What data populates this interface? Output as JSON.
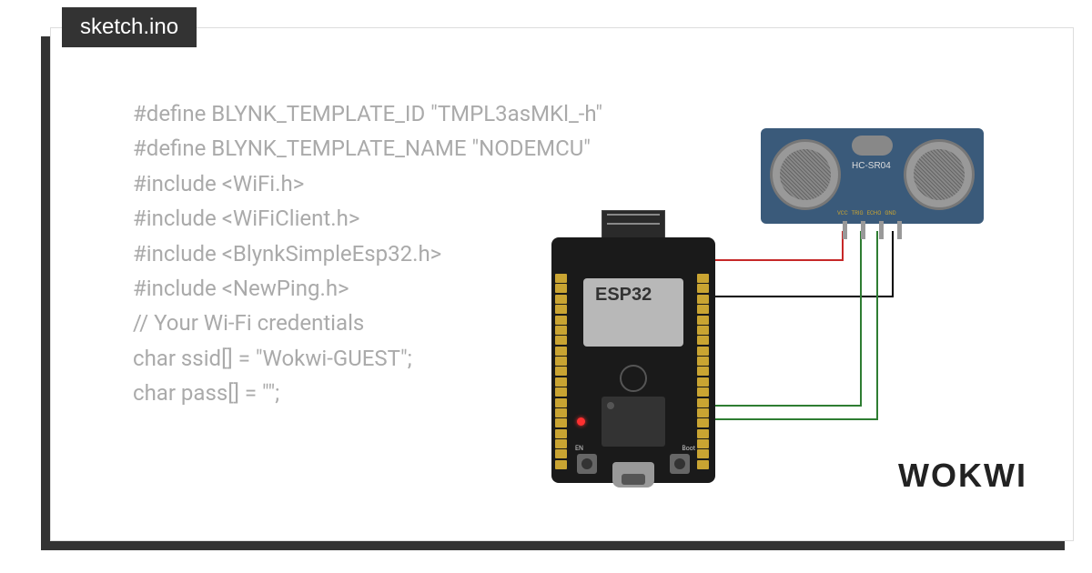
{
  "tab": {
    "filename": "sketch.ino"
  },
  "code": {
    "lines": [
      "#define BLYNK_TEMPLATE_ID \"TMPL3asMKl_-h\"",
      "#define BLYNK_TEMPLATE_NAME \"NODEMCU\"",
      "#include <WiFi.h>",
      "#include <WiFiClient.h>",
      "#include <BlynkSimpleEsp32.h>",
      "#include <NewPing.h>",
      "",
      "// Your Wi-Fi credentials",
      "char ssid[] = \"Wokwi-GUEST\";",
      "char pass[] = \"\";"
    ]
  },
  "components": {
    "esp32": {
      "label": "ESP32",
      "button_en": "EN",
      "button_boot": "Boot"
    },
    "hcsr04": {
      "label": "HC-SR04",
      "pins": [
        "VCC",
        "TRIG",
        "ECHO",
        "GND"
      ]
    }
  },
  "wires": [
    {
      "color": "#c62828",
      "from": "esp32-vcc",
      "to": "hcsr04-vcc"
    },
    {
      "color": "#000000",
      "from": "esp32-gnd",
      "to": "hcsr04-gnd"
    },
    {
      "color": "#2e7d32",
      "from": "esp32-pin1",
      "to": "hcsr04-trig"
    },
    {
      "color": "#2e7d32",
      "from": "esp32-pin2",
      "to": "hcsr04-echo"
    }
  ],
  "branding": {
    "logo": "WOKWI"
  }
}
